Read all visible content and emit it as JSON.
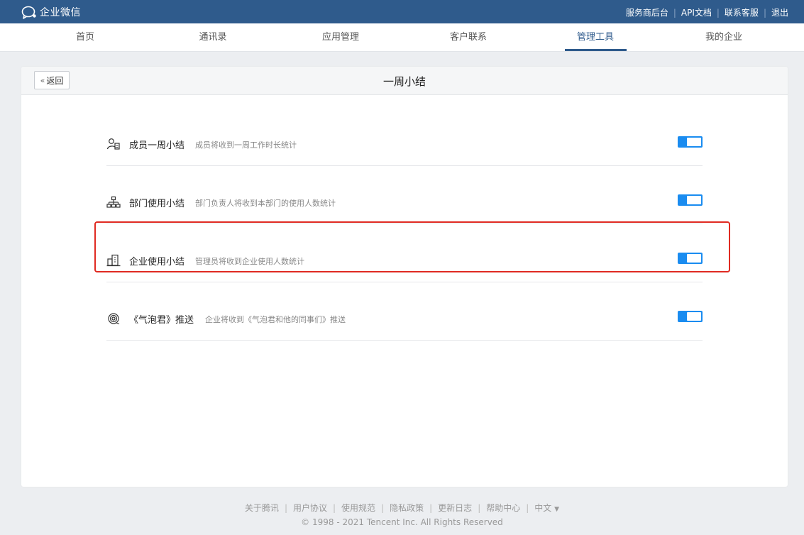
{
  "app": {
    "logo_text": "企业微信",
    "accent": "#2f5b8c",
    "toggle_color": "#1a8cf0",
    "highlight_color": "#e02b22"
  },
  "top_links": [
    "服务商后台",
    "API文档",
    "联系客服",
    "退出"
  ],
  "nav": {
    "items": [
      "首页",
      "通讯录",
      "应用管理",
      "客户联系",
      "管理工具",
      "我的企业"
    ],
    "active": "管理工具"
  },
  "page": {
    "back_label": "返回",
    "title": "一周小结"
  },
  "settings": [
    {
      "icon": "member-icon",
      "name": "成员一周小结",
      "desc": "成员将收到一周工作时长统计",
      "enabled": true
    },
    {
      "icon": "org-chart-icon",
      "name": "部门使用小结",
      "desc": "部门负责人将收到本部门的使用人数统计",
      "enabled": true
    },
    {
      "icon": "building-icon",
      "name": "企业使用小结",
      "desc": "管理员将收到企业使用人数统计",
      "enabled": true,
      "highlighted": true
    },
    {
      "icon": "bubble-icon",
      "name": "《气泡君》推送",
      "desc": "企业将收到《气泡君和他的同事们》推送",
      "enabled": true
    }
  ],
  "footer": {
    "links": [
      "关于腾讯",
      "用户协议",
      "使用规范",
      "隐私政策",
      "更新日志",
      "帮助中心",
      "中文"
    ],
    "language_arrow": "▼",
    "copyright": "© 1998 - 2021 Tencent Inc. All Rights Reserved"
  }
}
